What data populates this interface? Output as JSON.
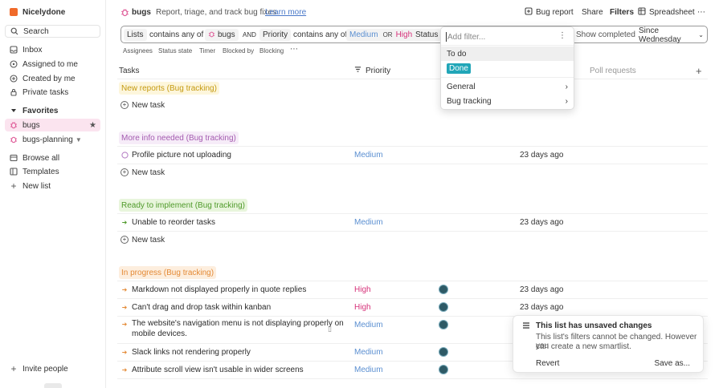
{
  "sidebar": {
    "workspace": "Nicelydone",
    "search": "Search",
    "inbox": "Inbox",
    "assigned": "Assigned to me",
    "created": "Created by me",
    "private": "Private tasks",
    "favorites": "Favorites",
    "fav_bugs": "bugs",
    "fav_planning": "bugs-planning",
    "browse": "Browse all",
    "templates": "Templates",
    "new_list": "New list",
    "invite": "Invite people"
  },
  "header": {
    "title": "bugs",
    "description": "Report, triage, and track bug fixes",
    "learn_more": "Learn more",
    "bug_report": "Bug report",
    "share": "Share",
    "filters": "Filters",
    "spreadsheet": "Spreadsheet"
  },
  "filter": {
    "lists": "Lists",
    "contains_any_of": "contains any of",
    "bugs": "bugs",
    "and": "AND",
    "priority": "Priority",
    "contains_any_of_2": "contains any of",
    "medium": "Medium",
    "or": "OR",
    "high": "High",
    "status": "Status",
    "add_filter_placeholder": "Add filter...",
    "show_completed": "Show completed",
    "since": "Since Wednesday"
  },
  "subfilters": [
    "Assignees",
    "Status state",
    "Timer",
    "Blocked by",
    "Blocking"
  ],
  "columns": {
    "tasks": "Tasks",
    "priority": "Priority",
    "poll": "Poll requests"
  },
  "dropdown": {
    "to_do": "To do",
    "done": "Done",
    "general": "General",
    "bug_tracking": "Bug tracking"
  },
  "groups": {
    "new_reports": "New reports (Bug tracking)",
    "more_info": "More info needed (Bug tracking)",
    "ready": "Ready to implement (Bug tracking)",
    "in_progress": "In progress (Bug tracking)"
  },
  "new_task": "New task",
  "tasks": {
    "t1": {
      "name": "Profile picture not uploading",
      "priority": "Medium",
      "date": "23 days ago"
    },
    "t2": {
      "name": "Unable to reorder tasks",
      "priority": "Medium",
      "date": "23 days ago"
    },
    "t3": {
      "name": "Markdown not displayed properly in quote replies",
      "priority": "High",
      "date": "23 days ago"
    },
    "t4": {
      "name": "Can't drag and drop task within kanban",
      "priority": "High",
      "date": "23 days ago"
    },
    "t5": {
      "name1": "The website's navigation menu is not displaying properly on",
      "name2": "mobile devices.",
      "priority": "Medium"
    },
    "t6": {
      "name": "Slack links not rendering properly",
      "priority": "Medium"
    },
    "t7": {
      "name": "Attribute scroll view isn't usable in wider screens",
      "priority": "Medium"
    }
  },
  "toast": {
    "title": "This list has unsaved changes",
    "body1": "This list's filters cannot be changed. However you",
    "body2": "can create a new smartlist.",
    "revert": "Revert",
    "save_as": "Save as..."
  },
  "colors": {
    "medium": "#5b8fd1",
    "high": "#d6327a",
    "new_reports_bg": "#fdf6dc",
    "new_reports_fg": "#c59a10",
    "more_info_bg": "#f6ecf8",
    "more_info_fg": "#a45bb0",
    "ready_bg": "#e8f5dc",
    "ready_fg": "#4f9a2a",
    "in_progress_bg": "#fdeede",
    "in_progress_fg": "#e48a36"
  }
}
